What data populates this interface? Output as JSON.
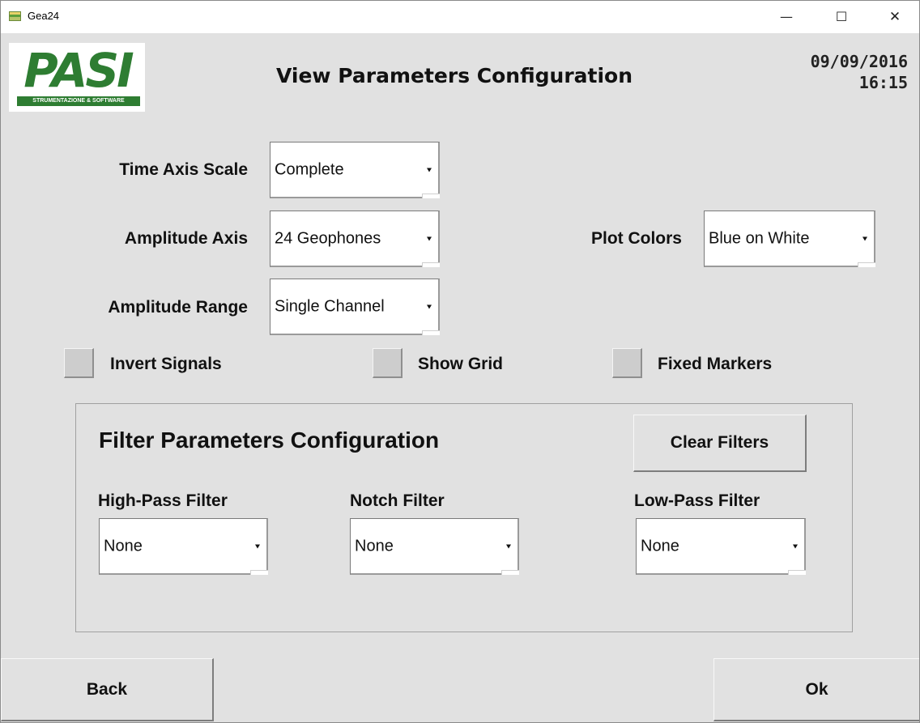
{
  "window": {
    "title": "Gea24",
    "minimize_glyph": "—",
    "maximize_glyph": "☐",
    "close_glyph": "✕"
  },
  "header": {
    "logo_text": "PASI",
    "logo_tagline": "STRUMENTAZIONE & SOFTWARE",
    "title": "View Parameters Configuration",
    "date": "09/09/2016",
    "time": "16:15"
  },
  "view": {
    "time_axis_scale": {
      "label": "Time Axis Scale",
      "value": "Complete"
    },
    "amplitude_axis": {
      "label": "Amplitude Axis",
      "value": "24 Geophones"
    },
    "amplitude_range": {
      "label": "Amplitude Range",
      "value": "Single Channel"
    },
    "plot_colors": {
      "label": "Plot Colors",
      "value": "Blue on White"
    },
    "invert_signals": {
      "label": "Invert Signals",
      "checked": false
    },
    "show_grid": {
      "label": "Show Grid",
      "checked": false
    },
    "fixed_markers": {
      "label": "Fixed Markers",
      "checked": false
    }
  },
  "filters": {
    "title": "Filter Parameters Configuration",
    "clear_label": "Clear Filters",
    "high_pass": {
      "label": "High-Pass Filter",
      "value": "None"
    },
    "notch": {
      "label": "Notch Filter",
      "value": "None"
    },
    "low_pass": {
      "label": "Low-Pass Filter",
      "value": "None"
    }
  },
  "footer": {
    "back_label": "Back",
    "ok_label": "Ok"
  },
  "colors": {
    "window_bg": "#e1e1e1",
    "logo_green": "#2e7d32"
  }
}
